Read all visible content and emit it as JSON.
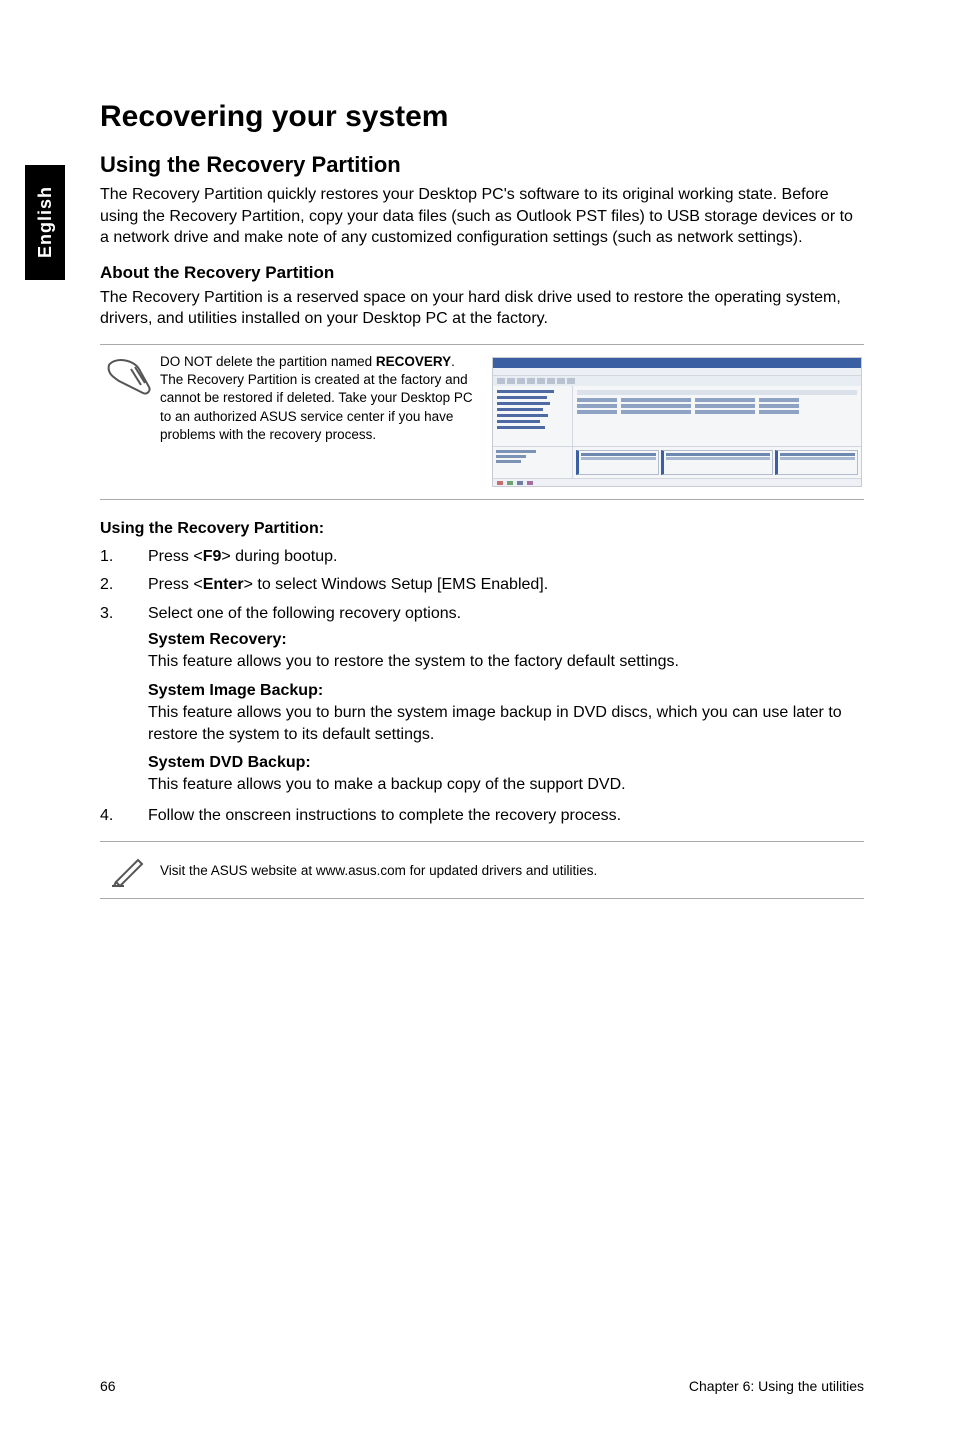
{
  "side_tab": "English",
  "h1": "Recovering your system",
  "h2": "Using the Recovery Partition",
  "intro": "The Recovery Partition quickly restores your Desktop PC's software to its original working state. Before using the Recovery Partition, copy your data files (such as Outlook PST files) to USB storage devices or to a network drive and make note of any customized configuration settings (such as network settings).",
  "h3_about": "About the Recovery Partition",
  "about_p": "The Recovery Partition is a reserved space on your hard disk drive used to restore the operating system, drivers, and utilities installed on your Desktop PC at the factory.",
  "warn_pre": "DO NOT delete the partition named ",
  "warn_bold": "RECOVERY",
  "warn_post": ". The Recovery Partition is created at the factory and cannot be restored if deleted. Take your Desktop PC to an authorized ASUS service center if you have problems with the recovery process.",
  "using_h": "Using the Recovery Partition:",
  "steps": {
    "s1_num": "1.",
    "s1_pre": "Press <",
    "s1_bold": "F9",
    "s1_post": "> during bootup.",
    "s2_num": "2.",
    "s2_pre": "Press <",
    "s2_bold": "Enter",
    "s2_post": "> to select Windows Setup [EMS Enabled].",
    "s3_num": "3.",
    "s3_txt": "Select one of the following recovery options.",
    "sr_h": "System Recovery:",
    "sr_p": "This feature allows you to restore the system to the factory default settings.",
    "sib_h": "System Image Backup:",
    "sib_p": "This feature allows you to burn the system image backup in DVD discs, which you can use later to restore the system to its default settings.",
    "sdb_h": "System DVD Backup:",
    "sdb_p": "This feature allows you to make a backup copy of the support DVD.",
    "s4_num": "4.",
    "s4_txt": "Follow the onscreen instructions to complete the recovery process."
  },
  "tip": "Visit the ASUS website at www.asus.com for updated drivers and utilities.",
  "footer": {
    "page": "66",
    "chapter": "Chapter 6: Using the utilities"
  }
}
